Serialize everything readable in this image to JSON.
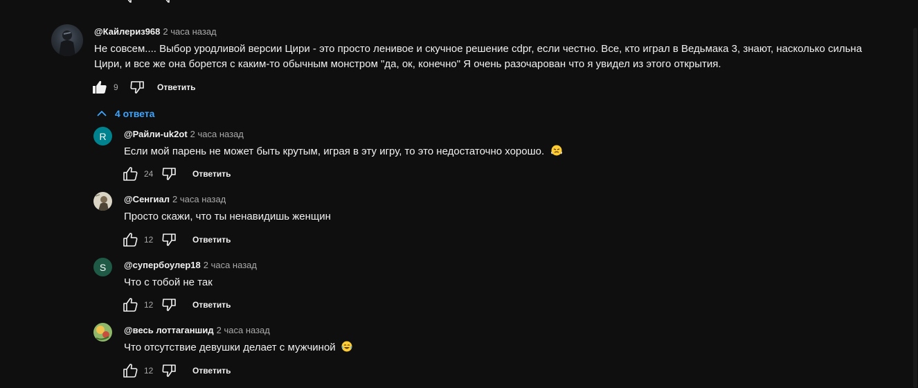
{
  "main_comment": {
    "author": "@Кайлериз968",
    "time": "2 часа назад",
    "text_line1": "Не совсем.... Выбор уродливой версии Цири - это просто ленивое и скучное решение cdpr, если честно. Все, кто играл в Ведьмака 3, знают, насколько сильна",
    "text_line2": "Цири, и все же она борется с каким-то обычным монстром \"да, ок, конечно\" Я очень разочарован что я увидел из этого открытия.",
    "likes": "9",
    "reply_label": "Ответить"
  },
  "replies_toggle": {
    "label": "4 ответа",
    "icon": "chevron-up-icon"
  },
  "replies": [
    {
      "author": "@Райли-uk2ot",
      "time": "2 часа назад",
      "text": "Если мой парень не может быть крутым, играя в эту игру, то это недостаточно хорошо.",
      "likes": "24",
      "reply_label": "Ответить",
      "avatar_letter": "R",
      "avatar_color": "#00838f",
      "emoji": "steam-face-emoji"
    },
    {
      "author": "@Сенгиал",
      "time": "2 часа назад",
      "text": "Просто скажи, что ты ненавидишь женщин",
      "likes": "12",
      "reply_label": "Ответить",
      "avatar_letter": "",
      "avatar_color": "#d9d4c4"
    },
    {
      "author": "@супербоулер18",
      "time": "2 часа назад",
      "text": "Что с тобой не так",
      "likes": "12",
      "reply_label": "Ответить",
      "avatar_letter": "S",
      "avatar_color": "#1e5a45"
    },
    {
      "author": "@весь лоттаганшид",
      "time": "2 часа назад",
      "text": "Что отсутствие девушки делает с мужчиной",
      "likes": "12",
      "reply_label": "Ответить",
      "avatar_letter": "",
      "avatar_color": "#8fb86a",
      "emoji": "tears-of-joy-emoji"
    }
  ],
  "colors": {
    "background": "#0f0f0f",
    "link_blue": "#3ea6ff",
    "secondary_text": "#aaaaaa"
  }
}
